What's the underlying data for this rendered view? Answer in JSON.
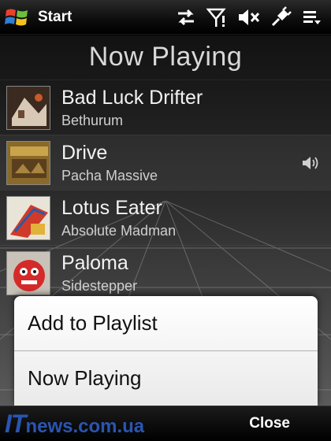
{
  "status_bar": {
    "title": "Start",
    "icons": [
      "windows-start-logo-icon",
      "data-sync-icon",
      "signal-icon",
      "volume-muted-icon",
      "usb-power-icon",
      "menu-icon"
    ]
  },
  "page": {
    "title": "Now Playing"
  },
  "tracks": [
    {
      "song": "Bad Luck Drifter",
      "artist": "Bethurum"
    },
    {
      "song": "Drive",
      "artist": "Pacha Massive",
      "playing": true
    },
    {
      "song": "Lotus Eater",
      "artist": "Absolute Madman"
    },
    {
      "song": "Paloma",
      "artist": "Sidestepper"
    }
  ],
  "context_menu": {
    "items": [
      "Add to Playlist",
      "Now Playing"
    ]
  },
  "bottom_bar": {
    "watermark_it": "IT",
    "watermark_rest": "news.com.ua",
    "close_label": "Close"
  }
}
